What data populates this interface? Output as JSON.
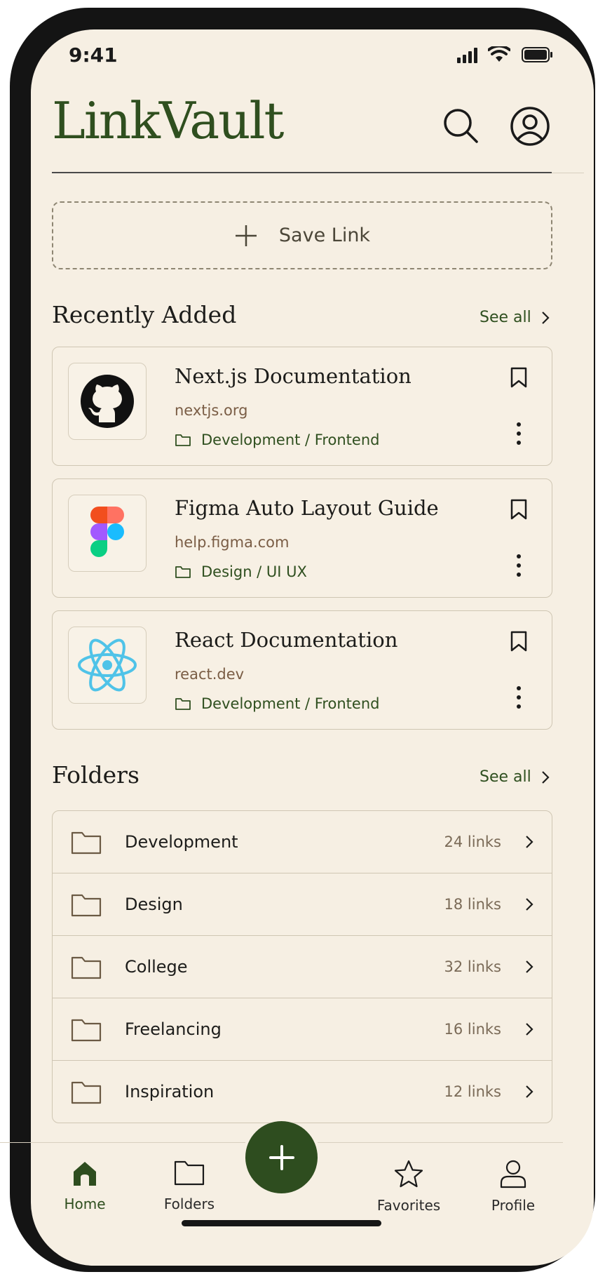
{
  "status_bar": {
    "time": "9:41"
  },
  "header": {
    "app_title": "LinkVault"
  },
  "save_link": {
    "label": "Save Link"
  },
  "recent": {
    "title": "Recently Added",
    "see_all": "See all",
    "items": [
      {
        "title": "Next.js Documentation",
        "url": "nextjs.org",
        "folder": "Development / Frontend",
        "icon": "github-icon"
      },
      {
        "title": "Figma Auto Layout Guide",
        "url": "help.figma.com",
        "folder": "Design / UI UX",
        "icon": "figma-icon"
      },
      {
        "title": "React Documentation",
        "url": "react.dev",
        "folder": "Development / Frontend",
        "icon": "react-icon"
      }
    ]
  },
  "folders": {
    "title": "Folders",
    "see_all": "See all",
    "items": [
      {
        "name": "Development",
        "count": "24 links"
      },
      {
        "name": "Design",
        "count": "18 links"
      },
      {
        "name": "College",
        "count": "32 links"
      },
      {
        "name": "Freelancing",
        "count": "16 links"
      },
      {
        "name": "Inspiration",
        "count": "12 links"
      }
    ]
  },
  "bottom_nav": {
    "home": "Home",
    "folders": "Folders",
    "favorites": "Favorites",
    "profile": "Profile",
    "active": "home"
  },
  "colors": {
    "brand_green": "#2f4f1f",
    "background": "#f6efe3",
    "url_brown": "#7a5d45"
  }
}
